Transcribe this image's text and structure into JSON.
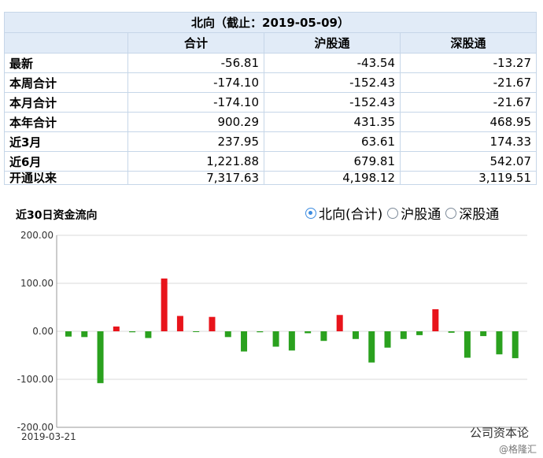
{
  "table": {
    "title": "北向（截止：2019-05-09）",
    "columns": [
      "合计",
      "沪股通",
      "深股通"
    ],
    "rows": [
      {
        "label": "最新",
        "values": [
          "-56.81",
          "-43.54",
          "-13.27"
        ]
      },
      {
        "label": "本周合计",
        "values": [
          "-174.10",
          "-152.43",
          "-21.67"
        ]
      },
      {
        "label": "本月合计",
        "values": [
          "-174.10",
          "-152.43",
          "-21.67"
        ]
      },
      {
        "label": "本年合计",
        "values": [
          "900.29",
          "431.35",
          "468.95"
        ]
      },
      {
        "label": "近3月",
        "values": [
          "237.95",
          "63.61",
          "174.33"
        ]
      },
      {
        "label": "近6月",
        "values": [
          "1,221.88",
          "679.81",
          "542.07"
        ]
      },
      {
        "label": "开通以来",
        "values": [
          "7,317.63",
          "4,198.12",
          "3,119.51"
        ]
      }
    ]
  },
  "chart_header": {
    "title": "近30日资金流向",
    "options": [
      {
        "label": "北向(合计)",
        "selected": true
      },
      {
        "label": "沪股通",
        "selected": false
      },
      {
        "label": "深股通",
        "selected": false
      }
    ]
  },
  "watermark": {
    "brand": "公司资本论",
    "sub": "@格隆汇"
  },
  "chart_data": {
    "type": "bar",
    "title": "近30日资金流向",
    "ylim": [
      -200,
      200
    ],
    "yticks": [
      "200.00",
      "100.00",
      "0.00",
      "-100.00",
      "-200.00"
    ],
    "yticks_values": [
      200,
      100,
      0,
      -100,
      -200
    ],
    "x_start_label": "2019-03-21",
    "grid": "horizontal",
    "positive_color": "#e8141b",
    "negative_color": "#2aa11e",
    "values": [
      -11,
      -12,
      -108,
      10,
      -2,
      -14,
      110,
      32,
      -1,
      30,
      -12,
      -42,
      -2,
      -32,
      -40,
      -4,
      -20,
      34,
      -16,
      -65,
      -34,
      -16,
      -8,
      46,
      -3,
      -55,
      -10,
      -48,
      -56
    ]
  }
}
